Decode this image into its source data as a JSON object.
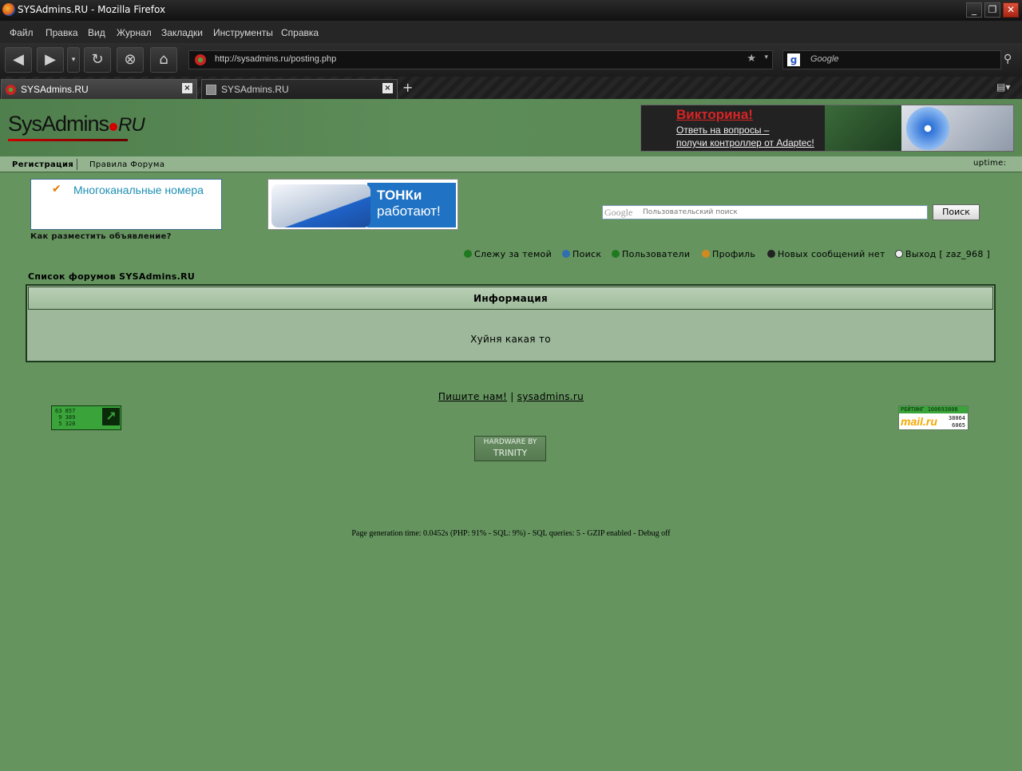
{
  "window": {
    "title": "SYSAdmins.RU - Mozilla Firefox",
    "minimize": "_",
    "restore": "❐",
    "close": "✕"
  },
  "menu": [
    "Файл",
    "Правка",
    "Вид",
    "Журнал",
    "Закладки",
    "Инструменты",
    "Справка"
  ],
  "toolbar": {
    "url": "http://sysadmins.ru/posting.php",
    "search_placeholder": "Google",
    "search_engine_letter": "g"
  },
  "tabs": [
    {
      "label": "SYSAdmins.RU"
    },
    {
      "label": "SYSAdmins.RU"
    }
  ],
  "header": {
    "logo_main": "SysAdmins",
    "logo_suffix": "RU",
    "banner": {
      "title": "Викторина!",
      "line1": "Ответь на вопросы –",
      "line2": "получи контроллер от Adaptec!"
    }
  },
  "forumnav": {
    "register": "Регистрация",
    "rules": "Правила Форума",
    "uptime": "uptime:"
  },
  "ads": {
    "text_ad_label": "Многоканальные номера",
    "how_to_advertise": "Как разместить объявление?",
    "tonki_line1": "ТОНКи",
    "tonki_line2": "работают!"
  },
  "site_search": {
    "logo": "Google",
    "placeholder": "Пользовательский поиск",
    "button": "Поиск"
  },
  "navlinks": [
    {
      "label": "Слежу за темой",
      "color": "#1f7a1f"
    },
    {
      "label": "Поиск",
      "color": "#2f6fb0"
    },
    {
      "label": "Пользователи",
      "color": "#1f7a1f"
    },
    {
      "label": "Профиль",
      "color": "#d08a1f"
    },
    {
      "label": "Новых сообщений нет",
      "color": "#222222"
    },
    {
      "label": "Выход [ zaz_968 ]",
      "color": "#eeeeee"
    }
  ],
  "breadcrumb": "Список форумов SYSAdmins.RU",
  "info": {
    "heading": "Информация",
    "message": "Хуйня какая то"
  },
  "footer": {
    "contact": "Пишите нам!",
    "separator": "|",
    "site": "sysadmins.ru",
    "counter1_text": "63 857\n 9 389\n 5 328",
    "counter2_top": "РЕЙТИНГ 100693808",
    "counter2_brand": "mail.ru",
    "counter2_n1": "38064",
    "counter2_n2": "6065",
    "trinity_line1": "HARDWARE BY",
    "trinity_line2": "TRINITY",
    "generation": "Page generation time: 0.0452s (PHP: 91% - SQL: 9%) - SQL queries: 5 - GZIP enabled - Debug off"
  }
}
